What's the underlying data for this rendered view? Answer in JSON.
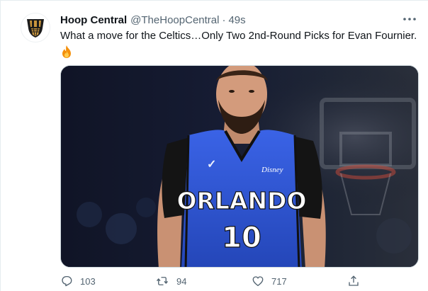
{
  "tweet": {
    "display_name": "Hoop Central",
    "handle": "@TheHoopCentral",
    "separator": "·",
    "time": "49s",
    "text": "What a move for the Celtics…Only Two 2nd-Round Picks for Evan Fournier.",
    "emoji": "🔥"
  },
  "media": {
    "jersey_team": "ORLANDO",
    "jersey_number": "10",
    "jersey_sponsor": "Disney"
  },
  "actions": {
    "reply_count": "103",
    "retweet_count": "94",
    "like_count": "717"
  },
  "colors": {
    "text_primary": "#0f1419",
    "text_secondary": "#536471",
    "jersey_blue": "#2f57d8",
    "avatar_gold": "#c9953c"
  },
  "icons": {
    "avatar": "hoop-central-logo",
    "more": "more-icon",
    "reply": "reply-icon",
    "retweet": "retweet-icon",
    "like": "heart-icon",
    "share": "share-icon"
  }
}
